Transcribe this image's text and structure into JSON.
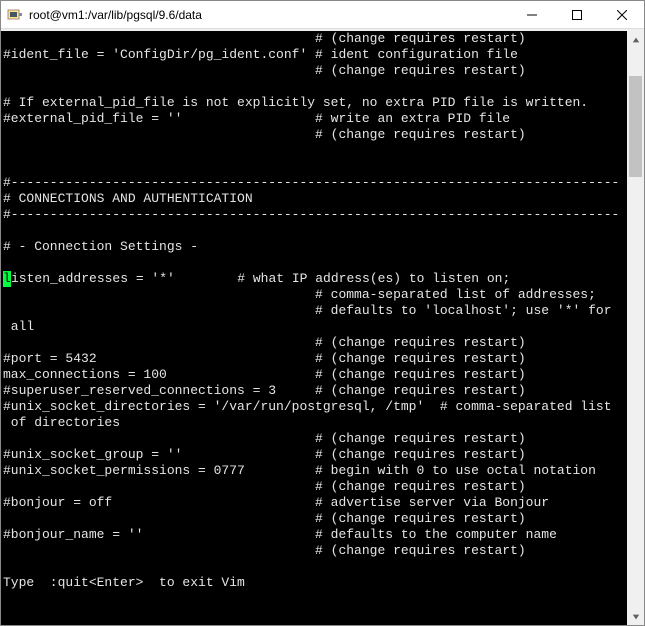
{
  "window": {
    "title": "root@vm1:/var/lib/pgsql/9.6/data",
    "app_icon": "putty-icon"
  },
  "terminal": {
    "cursor_char": "l",
    "lines": [
      "                                        # (change requires restart)",
      "#ident_file = 'ConfigDir/pg_ident.conf' # ident configuration file",
      "                                        # (change requires restart)",
      "",
      "# If external_pid_file is not explicitly set, no extra PID file is written.",
      "#external_pid_file = ''                 # write an extra PID file",
      "                                        # (change requires restart)",
      "",
      "",
      "#------------------------------------------------------------------------------",
      "# CONNECTIONS AND AUTHENTICATION",
      "#------------------------------------------------------------------------------",
      "",
      "# - Connection Settings -",
      "",
      "",
      "                                        # (change requires restart)",
      "#port = 5432                            # (change requires restart)",
      "max_connections = 100                   # (change requires restart)",
      "#superuser_reserved_connections = 3     # (change requires restart)",
      "#unix_socket_directories = '/var/run/postgresql, /tmp'  # comma-separated list",
      " of directories",
      "                                        # (change requires restart)",
      "#unix_socket_group = ''                 # (change requires restart)",
      "#unix_socket_permissions = 0777         # begin with 0 to use octal notation",
      "                                        # (change requires restart)",
      "#bonjour = off                          # advertise server via Bonjour",
      "                                        # (change requires restart)",
      "#bonjour_name = ''                      # defaults to the computer name",
      "                                        # (change requires restart)",
      "",
      "Type  :quit<Enter>  to exit Vim"
    ],
    "cursor_line_after": "isten_addresses = '*'        # what IP address(es) to listen on;",
    "cursor_followups": [
      "                                        # comma-separated list of addresses;",
      "                                        # defaults to 'localhost'; use '*' for",
      " all"
    ]
  }
}
